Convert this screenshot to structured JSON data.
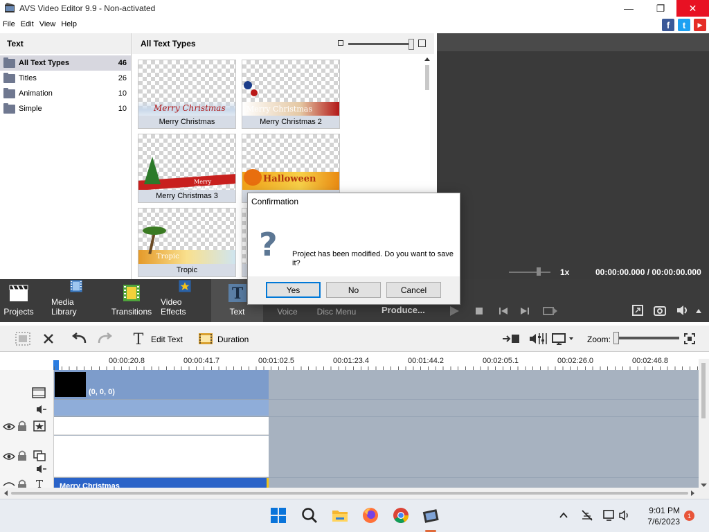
{
  "window": {
    "title": "AVS Video Editor 9.9 - Non-activated",
    "minimize": "—",
    "restore": "❐",
    "close": "✕"
  },
  "menu": [
    "File",
    "Edit",
    "View",
    "Help"
  ],
  "social": [
    {
      "name": "facebook",
      "glyph": "f",
      "color": "#3b5998"
    },
    {
      "name": "twitter",
      "glyph": "t",
      "color": "#1da1f2"
    },
    {
      "name": "youtube",
      "glyph": "▶",
      "color": "#e52d27"
    }
  ],
  "text_panel": {
    "title": "Text",
    "categories": [
      {
        "label": "All Text Types",
        "count": "46"
      },
      {
        "label": "Titles",
        "count": "26"
      },
      {
        "label": "Animation",
        "count": "10"
      },
      {
        "label": "Simple",
        "count": "10"
      }
    ]
  },
  "gallery": {
    "title": "All Text Types",
    "items": [
      {
        "label": "Merry Christmas",
        "overlay": "Merry Christmas"
      },
      {
        "label": "Merry Christmas 2",
        "overlay": "Merry Christmas"
      },
      {
        "label": "Merry Christmas 3",
        "overlay": "Merry Christmas"
      },
      {
        "label": "",
        "overlay": "Halloween"
      },
      {
        "label": "Tropic",
        "overlay": "Tropic"
      }
    ]
  },
  "playback": {
    "speed": "1x",
    "time": "00:00:00.000 / 00:00:00.000"
  },
  "tools": [
    {
      "label": "Projects"
    },
    {
      "label": "Media Library"
    },
    {
      "label": "Transitions"
    },
    {
      "label": "Video Effects"
    },
    {
      "label": "Text"
    },
    {
      "label": "Voice"
    },
    {
      "label": "Disc Menu"
    }
  ],
  "produce": "Produce...",
  "editbar": {
    "edit_text": "Edit Text",
    "duration": "Duration",
    "zoom_label": "Zoom:"
  },
  "ruler": [
    "00:00:20.8",
    "00:00:41.7",
    "00:01:02.5",
    "00:01:23.4",
    "00:01:44.2",
    "00:02:05.1",
    "00:02:26.0",
    "00:02:46.8"
  ],
  "timeline": {
    "video_clip_label": "(0, 0, 0)",
    "text_clip_label": "Merry Christmas"
  },
  "dialog": {
    "title": "Confirmation",
    "message": "Project has been modified. Do you want to save it?",
    "yes": "Yes",
    "no": "No",
    "cancel": "Cancel"
  },
  "taskbar": {
    "time": "9:01 PM",
    "date": "7/6/2023",
    "notifications": "1"
  }
}
